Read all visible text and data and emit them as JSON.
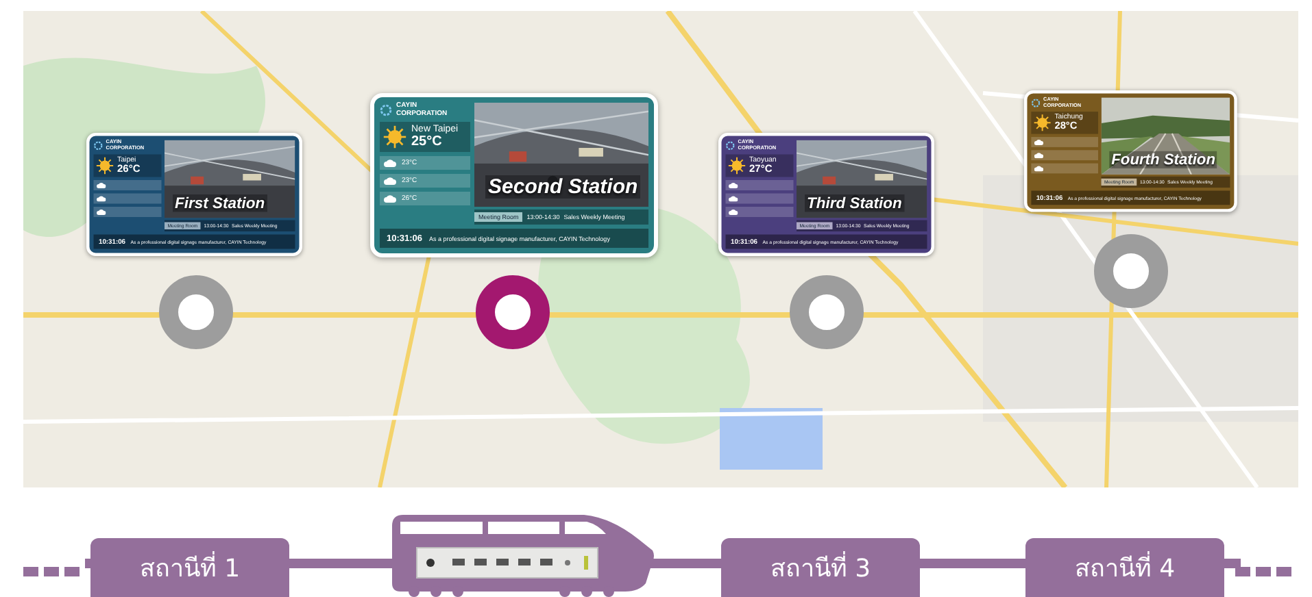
{
  "stations": [
    {
      "name": "First Station",
      "brand": "CAYIN CORPORATION",
      "city": "Taipei",
      "temperature": "26°C",
      "event_room": "Meeting Room",
      "event_time": "13:00-14:30",
      "event_title": "Sales Weekly Meeting",
      "clock": "10:31:06",
      "ticker": "As a professional digital signage manufacturer, CAYIN Technology",
      "color": "#1c4e72",
      "selected": false
    },
    {
      "name": "Second Station",
      "brand": "CAYIN CORPORATION",
      "city": "New Taipei",
      "temperature": "25°C",
      "forecast": [
        "23°C",
        "23°C",
        "26°C"
      ],
      "event_room": "Meeting Room",
      "event_time": "13:00-14:30",
      "event_title": "Sales Weekly Meeting",
      "clock": "10:31:06",
      "ticker": "As a professional digital signage manufacturer, CAYIN Technology",
      "color": "#2a7d82",
      "selected": true
    },
    {
      "name": "Third Station",
      "brand": "CAYIN CORPORATION",
      "city": "Taoyuan",
      "temperature": "27°C",
      "event_room": "Meeting Room",
      "event_time": "13:00-14:30",
      "event_title": "Sales Weekly Meeting",
      "clock": "10:31:06",
      "ticker": "As a professional digital signage manufacturer, CAYIN Technology",
      "color": "#4b3f7e",
      "selected": false
    },
    {
      "name": "Fourth Station",
      "brand": "CAYIN CORPORATION",
      "city": "Taichung",
      "temperature": "28°C",
      "event_room": "Meeting Room",
      "event_time": "13:00-14:30",
      "event_title": "Sales Weekly Meeting",
      "clock": "10:31:06",
      "ticker": "As a professional digital signage manufacturer, CAYIN Technology",
      "color": "#7a5a1f",
      "selected": false
    }
  ],
  "route": [
    {
      "kind": "label",
      "text": "สถานีที่ 1"
    },
    {
      "kind": "train"
    },
    {
      "kind": "label",
      "text": "สถานีที่ 3"
    },
    {
      "kind": "label",
      "text": "สถานีที่ 4"
    }
  ]
}
